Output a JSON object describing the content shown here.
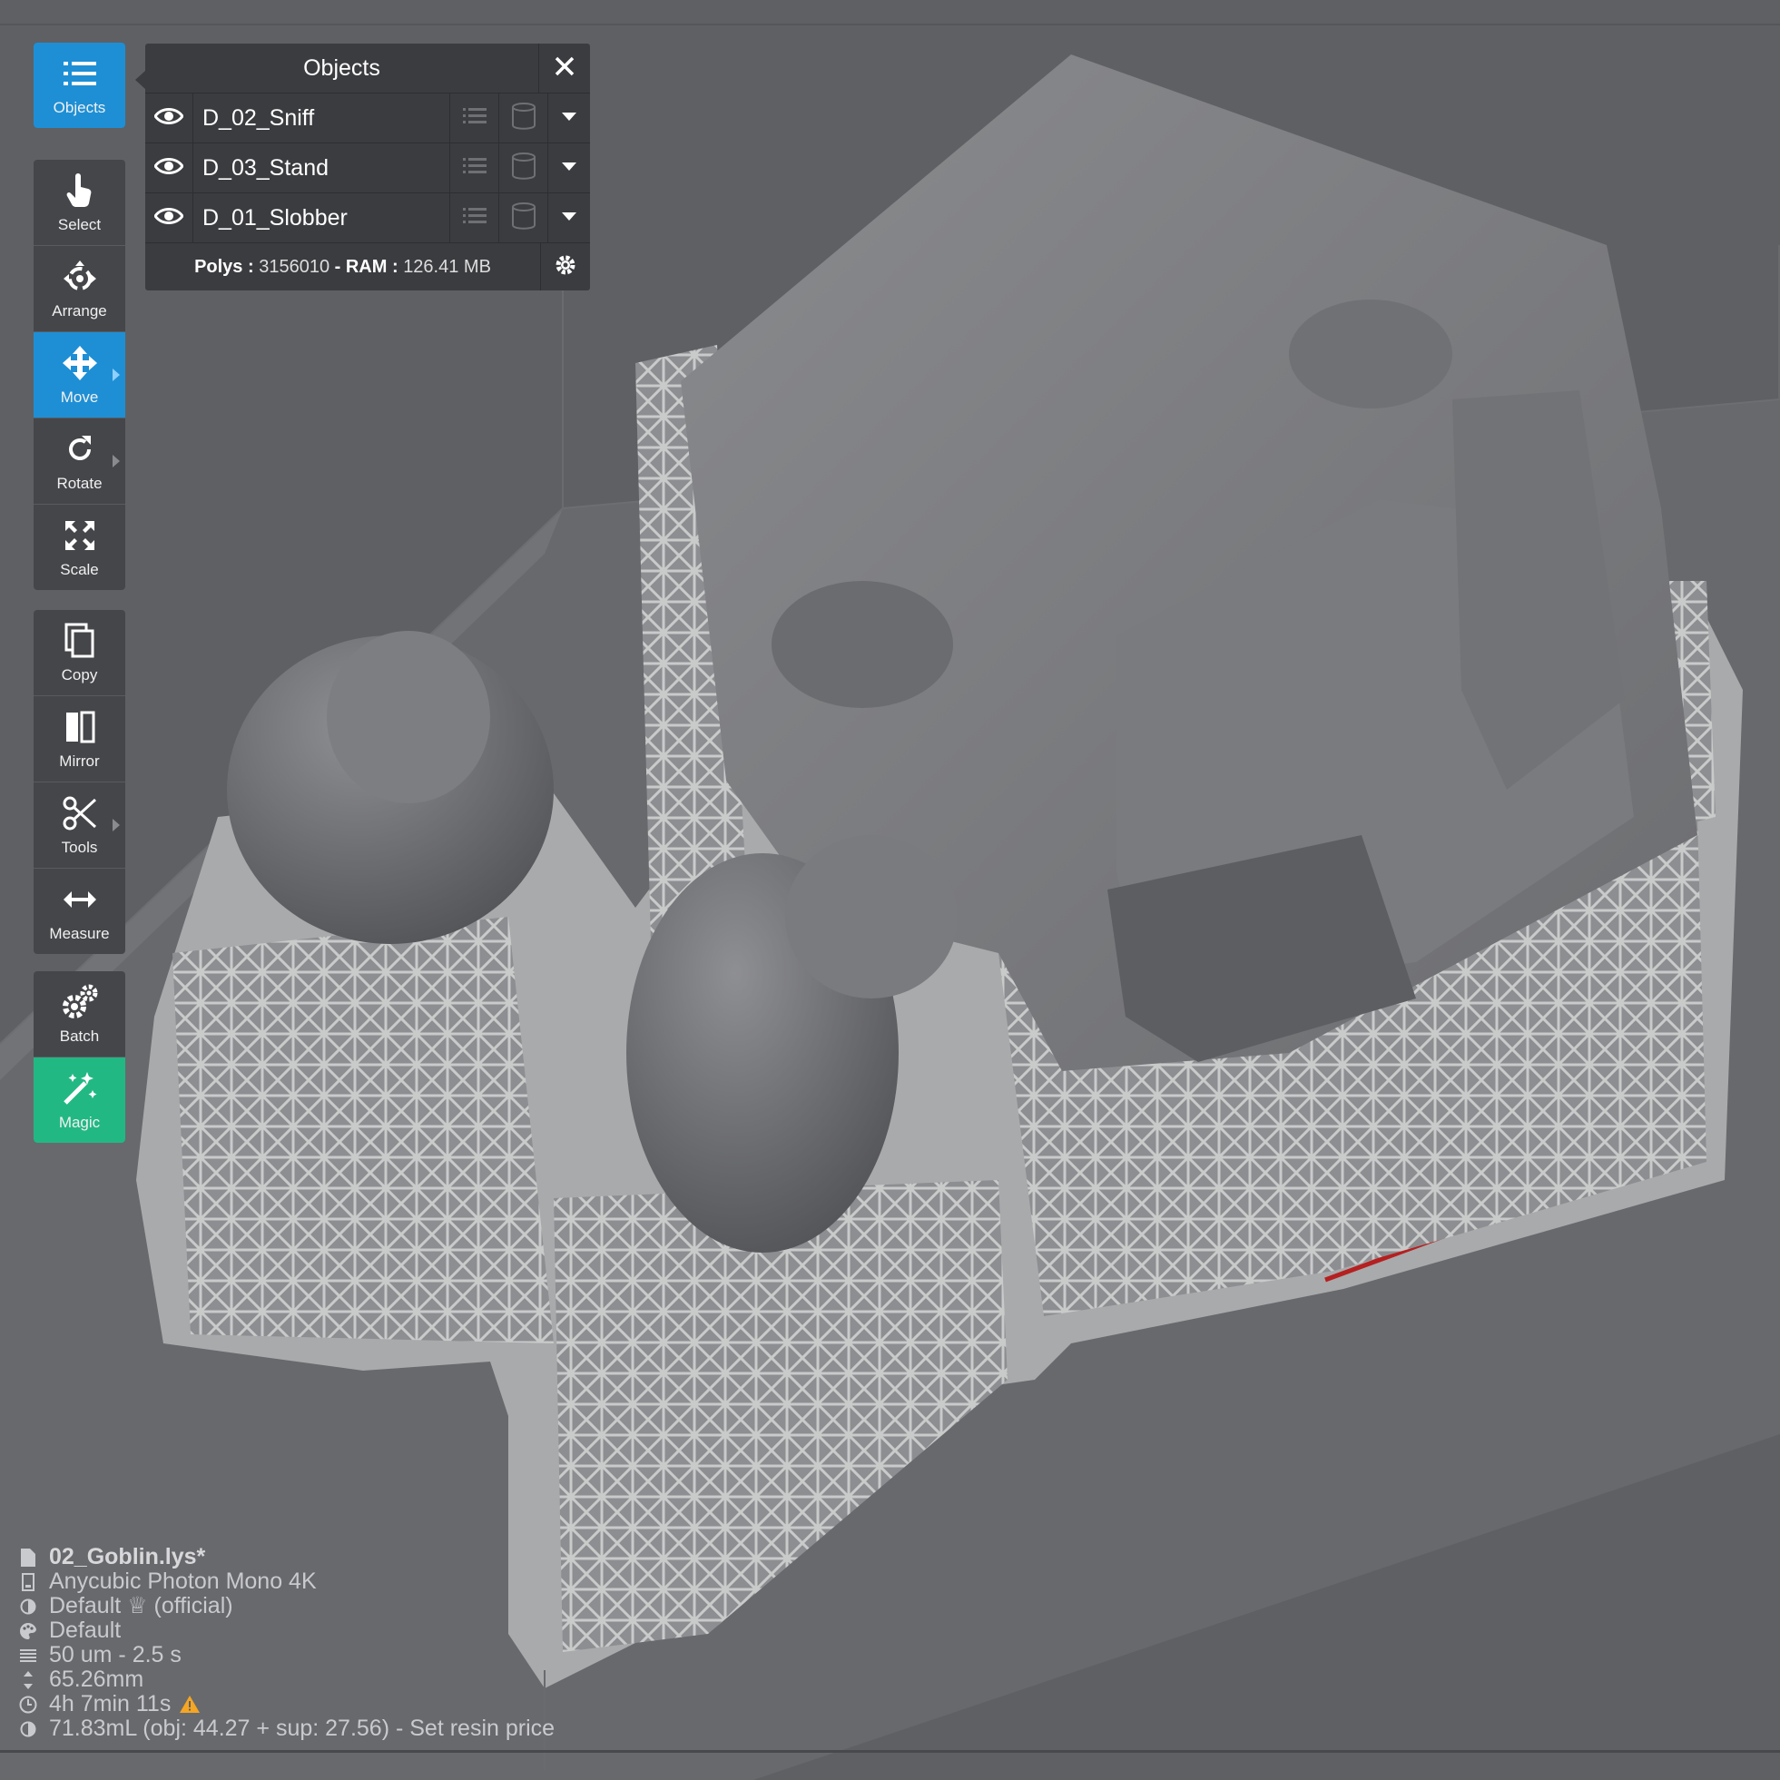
{
  "toolbar": {
    "objects": {
      "label": "Objects",
      "icon": "list-icon",
      "state": "active"
    },
    "tools": [
      {
        "label": "Select",
        "icon": "pointer-hand-icon"
      },
      {
        "label": "Arrange",
        "icon": "arrange-icon"
      },
      {
        "label": "Move",
        "icon": "move-arrows-icon",
        "state": "active"
      },
      {
        "label": "Rotate",
        "icon": "rotate-icon"
      },
      {
        "label": "Scale",
        "icon": "scale-icon"
      }
    ],
    "edit": [
      {
        "label": "Copy",
        "icon": "copy-icon"
      },
      {
        "label": "Mirror",
        "icon": "mirror-icon"
      },
      {
        "label": "Tools",
        "icon": "scissors-icon"
      },
      {
        "label": "Measure",
        "icon": "measure-icon"
      }
    ],
    "batch": {
      "label": "Batch",
      "icon": "gears-icon"
    },
    "magic": {
      "label": "Magic",
      "icon": "magic-wand-icon"
    }
  },
  "objects_panel": {
    "title": "Objects",
    "items": [
      {
        "name": "D_02_Sniff",
        "visible": true
      },
      {
        "name": "D_03_Stand",
        "visible": true
      },
      {
        "name": "D_01_Slobber",
        "visible": true
      }
    ],
    "polys_label": "Polys :",
    "polys_value": "3156010",
    "ram_label": "- RAM :",
    "ram_value": "126.41 MB"
  },
  "info": {
    "file": "02_Goblin.lys*",
    "printer": "Anycubic Photon Mono 4K",
    "resin_profile": "Default ♕ (official)",
    "material": "Default",
    "layers": "50 um - 2.5 s",
    "height": "65.26mm",
    "time": "4h 7min 11s",
    "volume": "71.83mL (obj: 44.27 + sup: 27.56) - Set resin price"
  },
  "colors": {
    "accent": "#1e8fd5",
    "magic": "#22b884",
    "warning": "#f5a623",
    "background": "#5f6064"
  }
}
